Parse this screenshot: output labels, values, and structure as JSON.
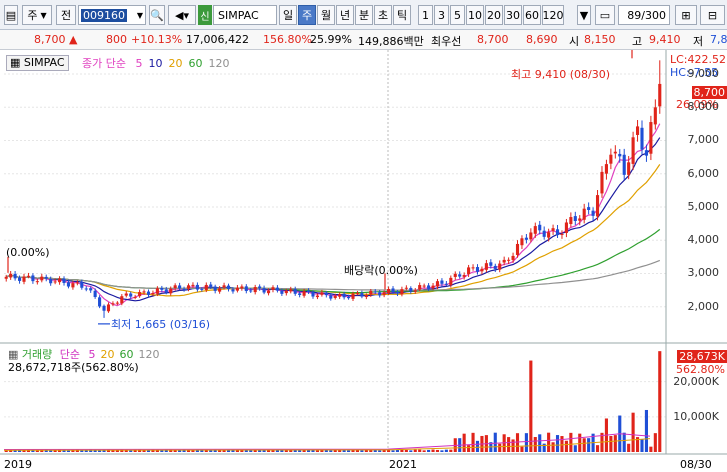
{
  "toolbar": {
    "market_label": "주",
    "jeon_label": "전",
    "code": "009160",
    "name": "SIMPAC",
    "badge": "신",
    "periods": [
      "일",
      "주",
      "월",
      "년",
      "분",
      "초",
      "틱"
    ],
    "selected_period": "주",
    "counts": [
      "1",
      "3",
      "5",
      "10",
      "20",
      "30",
      "60",
      "120"
    ],
    "page_counter": "89/300"
  },
  "quote": {
    "price": "8,700",
    "change_arrow": "▲",
    "change": "800",
    "change_pct": "+10.13%",
    "volume": "17,006,422",
    "volume_ratio": "156.80%",
    "turnover": "25.99%",
    "amount": "149,886백만",
    "best_label": "최우선",
    "best": "8,700",
    "ask": "8,690",
    "open_label": "시",
    "open": "8,150",
    "high_label": "고",
    "high": "9,410",
    "low_label": "저",
    "low": "7,8"
  },
  "price_panel": {
    "stock_label": "SIMPAC",
    "ma_title": "종가 단순",
    "ma_periods": [
      "5",
      "10",
      "20",
      "60",
      "120"
    ],
    "ma_colors": [
      "#e040c0",
      "#1a1aa0",
      "#e0a000",
      "#30a030",
      "#909090"
    ],
    "lc": "LC:422.52",
    "hc": "HC:-7.55",
    "current_tag": "8,700",
    "pct_tag": "26.09%",
    "high_annotation": "최고 9,410 (08/30)",
    "low_annotation": "최저 1,665 (03/16)",
    "start_annotation": "(0.00%)",
    "dividend_annotation": "배당락(0.00%)",
    "y_ticks": [
      "9,000",
      "8,000",
      "7,000",
      "6,000",
      "5,000",
      "4,000",
      "3,000",
      "2,000"
    ]
  },
  "volume_panel": {
    "title": "거래량",
    "ma_title": "단순",
    "ma_periods": [
      "5",
      "20",
      "60",
      "120"
    ],
    "ma_colors": [
      "#d030c0",
      "#e0a000",
      "#30a030",
      "#909090"
    ],
    "info": "28,672,718주(562.80%)",
    "current_tag": "28,673K",
    "pct_tag": "562.80%",
    "y_ticks": [
      "20,000K",
      "10,000K"
    ]
  },
  "x_axis": {
    "labels": [
      "2019",
      "2021",
      "08/30"
    ]
  },
  "colors": {
    "up": "#e0241a",
    "down": "#1f4fd6",
    "accent": "#4a79c7"
  },
  "chart_data": {
    "type": "candlestick",
    "title": "SIMPAC",
    "price_ylim": [
      1000,
      9600
    ],
    "volume_ylim": [
      0,
      29000
    ],
    "volume_unit": "K",
    "high": 9410,
    "low": 1665,
    "last_close": 8700
  }
}
